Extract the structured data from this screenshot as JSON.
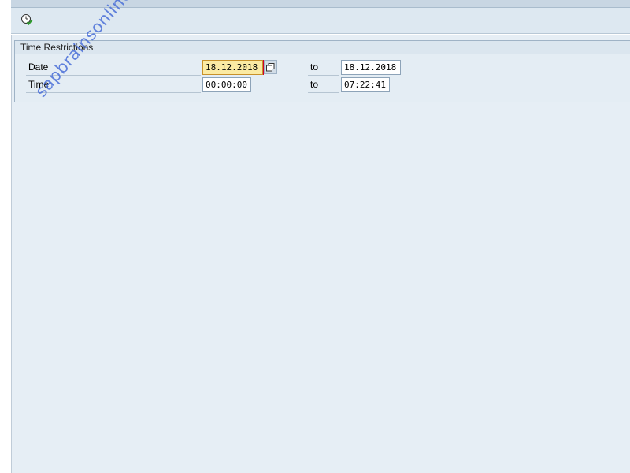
{
  "toolbar": {
    "execute_icon": "execute-icon"
  },
  "time_restrictions": {
    "title": "Time Restrictions",
    "date": {
      "label": "Date",
      "from": "18.12.2018",
      "to_label": "to",
      "to": "18.12.2018"
    },
    "time": {
      "label": "Time",
      "from": "00:00:00",
      "to_label": "to",
      "to": "07:22:41"
    }
  },
  "watermark": "sapbrainsonline.com",
  "colors": {
    "focus_field": "#fbeaa3",
    "watermark": "#4a6fd8"
  }
}
